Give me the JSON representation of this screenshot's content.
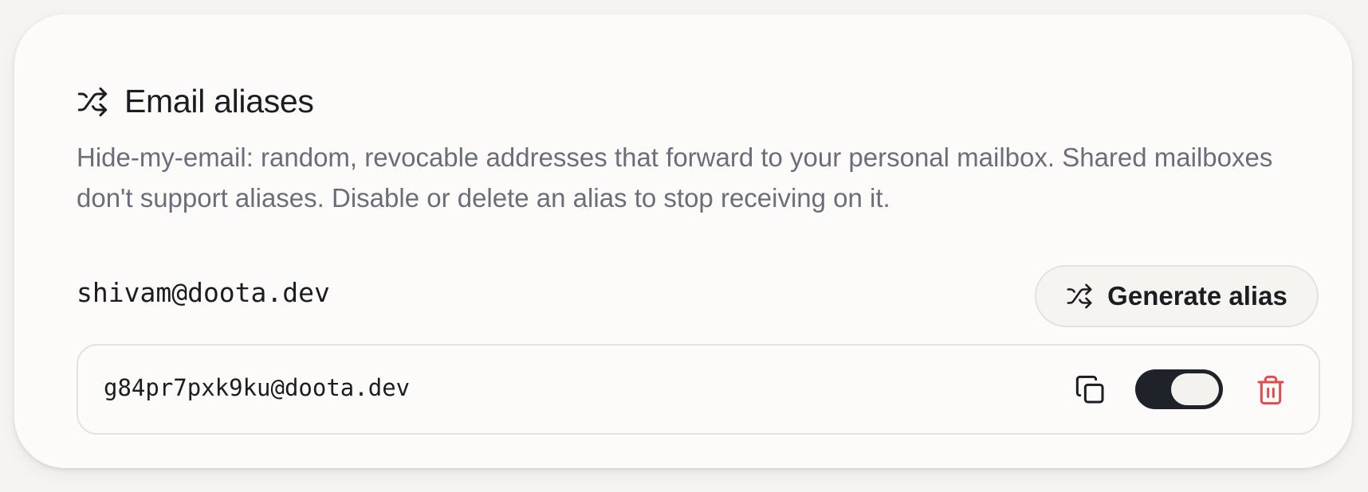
{
  "section": {
    "title": "Email aliases",
    "icon": "shuffle-icon",
    "description": "Hide-my-email: random, revocable addresses that forward to your personal mailbox. Shared mailboxes don't support aliases. Disable or delete an alias to stop receiving on it."
  },
  "account": {
    "email": "shivam@doota.dev"
  },
  "generate_button": {
    "label": "Generate alias",
    "icon": "shuffle-icon"
  },
  "aliases": [
    {
      "address": "g84pr7pxk9ku@doota.dev",
      "enabled": true,
      "copy_icon": "copy-icon",
      "delete_icon": "trash-icon"
    }
  ],
  "colors": {
    "text": "#1c1d22",
    "muted": "#6b6e7a",
    "toggle_on": "#1f2229",
    "danger": "#e5484d"
  }
}
